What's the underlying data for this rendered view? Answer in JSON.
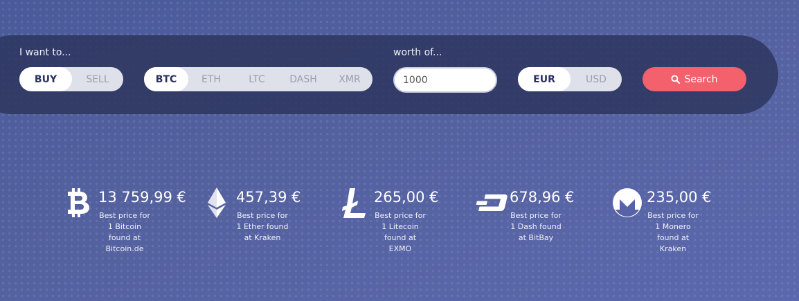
{
  "form": {
    "want_label": "I want to...",
    "worth_label": "worth of...",
    "action_options": [
      "BUY",
      "SELL"
    ],
    "action_selected": "BUY",
    "currency_options": [
      "BTC",
      "ETH",
      "LTC",
      "DASH",
      "XMR"
    ],
    "currency_selected": "BTC",
    "amount_value": "1000",
    "fiat_options": [
      "EUR",
      "USD"
    ],
    "fiat_selected": "EUR",
    "search_label": "Search"
  },
  "coins": [
    {
      "icon": "bitcoin-icon",
      "price": "13 759,99 €",
      "desc": "Best price for\n1 Bitcoin\nfound at\nBitcoin.de"
    },
    {
      "icon": "ethereum-icon",
      "price": "457,39 €",
      "desc": "Best price for\n1 Ether found\nat Kraken"
    },
    {
      "icon": "litecoin-icon",
      "price": "265,00 €",
      "desc": "Best price for\n1 Litecoin\nfound at\nEXMO"
    },
    {
      "icon": "dash-icon",
      "price": "678,96 €",
      "desc": "Best price for\n1 Dash found\nat BitBay"
    },
    {
      "icon": "monero-icon",
      "price": "235,00 €",
      "desc": "Best price for\n1 Monero\nfound at\nKraken"
    }
  ],
  "colors": {
    "search_button": "#f2616c",
    "panel": "#2c345c",
    "background": "#54619f"
  }
}
